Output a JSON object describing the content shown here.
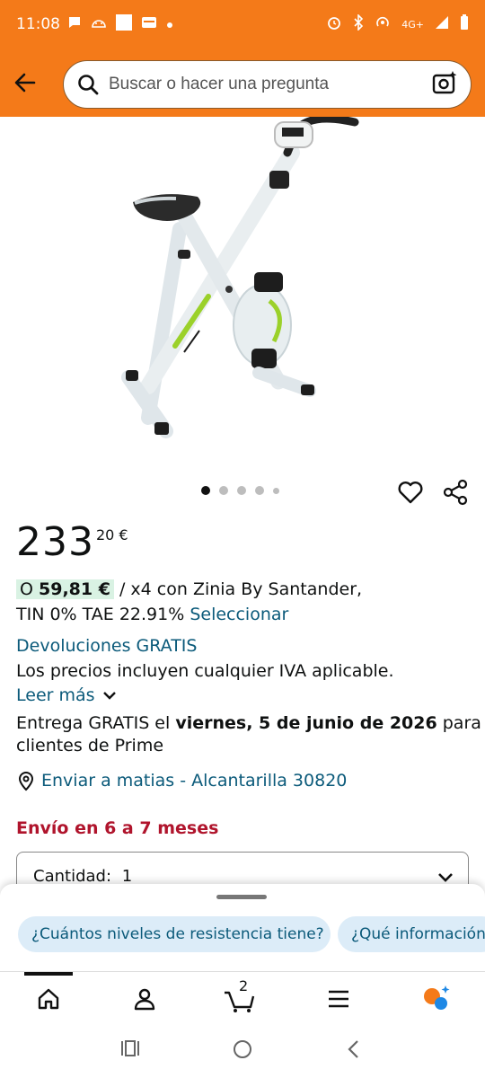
{
  "status_bar": {
    "time": "11:08",
    "network": "4G+",
    "icons": [
      "chat-bubble-icon",
      "android-debug-icon",
      "square-icon",
      "wallet-icon",
      "dot-icon",
      "alarm-icon",
      "bluetooth-icon",
      "hotspot-icon",
      "signal-icon",
      "battery-icon"
    ]
  },
  "header": {
    "search_placeholder": "Buscar o hacer una pregunta",
    "icons": [
      "back-arrow-icon",
      "search-icon",
      "camera-search-icon"
    ]
  },
  "gallery": {
    "image": "exercise-bike-product-image",
    "dot_count": 5,
    "active_index": 0
  },
  "product": {
    "price_whole": "233",
    "price_fraction": "20 €",
    "installment_prefix": "O ",
    "installment_amount": "59,81 €",
    "installment_text": " / x4 con Zinia By Santander,",
    "financing_terms": "TIN 0% TAE 22.91% ",
    "financing_select": "Seleccionar",
    "returns": "Devoluciones GRATIS",
    "vat_note": "Los precios incluyen cualquier IVA aplicable.",
    "read_more": "Leer más",
    "delivery_prefix": "Entrega GRATIS el ",
    "delivery_date": "viernes, 5 de junio de 2026",
    "delivery_suffix": " para",
    "delivery_line2": "clientes de Prime",
    "ship_to": "Enviar a matias - Alcantarilla 30820",
    "shipping_time": "Envío en 6 a 7 meses",
    "quantity_label": "Cantidad:",
    "quantity_value": "1"
  },
  "assistant": {
    "chips": [
      "¿Cuántos niveles de resistencia tiene?",
      "¿Qué información"
    ]
  },
  "bottom_nav": {
    "cart_count": "2",
    "items": [
      "home-icon",
      "account-icon",
      "cart-icon",
      "menu-icon",
      "rufus-icon"
    ]
  },
  "colors": {
    "accent": "#f47a19",
    "link": "#0b5a7a",
    "deal_red": "#b0142c",
    "installment_bg": "#d9f2e3",
    "chip_bg": "#dcecf8"
  }
}
